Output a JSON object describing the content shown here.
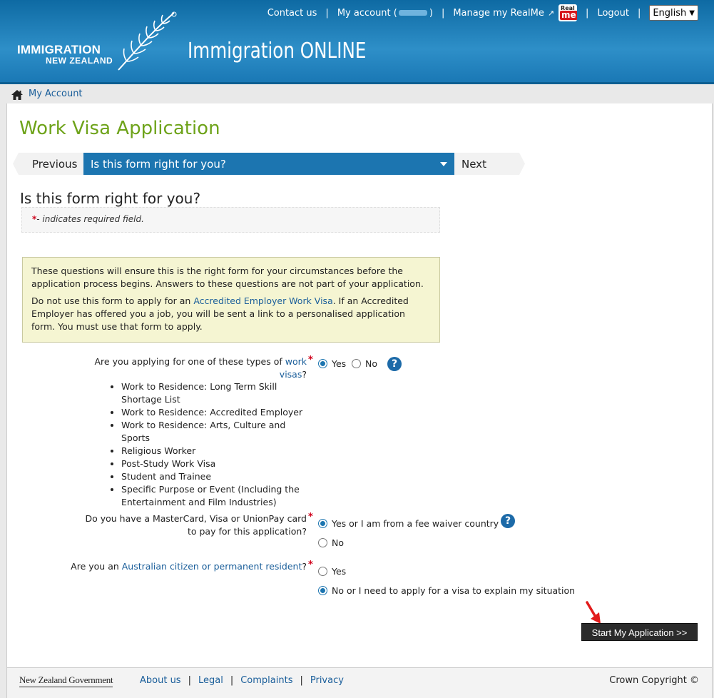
{
  "header": {
    "logo_line1": "IMMIGRATION",
    "logo_line2": "NEW ZEALAND",
    "site_title": "Immigration ONLINE",
    "nav": {
      "contact": "Contact us",
      "my_account": "My account (",
      "my_account_close": ")",
      "realme": "Manage my RealMe",
      "logout": "Logout",
      "language": "English"
    },
    "realme_badge_top": "Real",
    "realme_badge_bottom": "me"
  },
  "breadcrumb": {
    "label": "My Account"
  },
  "page": {
    "title": "Work Visa Application",
    "step": {
      "previous": "Previous",
      "current": "Is this form right for you?",
      "next": "Next"
    },
    "section_title": "Is this form right for you?",
    "required_star": "*",
    "required_note": "- indicates required field.",
    "info": {
      "p1": "These questions will ensure this is the right form for your circumstances before the application process begins. Answers to these questions are not part of your application.",
      "p2_before": "Do not use this form to apply for an ",
      "p2_link": "Accredited Employer Work Visa",
      "p2_after": ". If an Accredited Employer has offered you a job, you will be sent a link to a personalised application form. You must use that form to apply."
    }
  },
  "questions": {
    "q1": {
      "label_before": "Are you applying for one of these types of ",
      "label_link_a": "work",
      "label_link_b": "visas",
      "label_after": "?",
      "list": [
        "Work to Residence: Long Term Skill Shortage List",
        "Work to Residence: Accredited Employer",
        "Work to Residence: Arts, Culture and Sports",
        "Religious Worker",
        "Post-Study Work Visa",
        "Student and Trainee",
        "Specific Purpose or Event (Including the Entertainment and Film Industries)"
      ],
      "yes": "Yes",
      "no": "No"
    },
    "q2": {
      "label": "Do you have a MasterCard, Visa or UnionPay card to pay for this application?",
      "yes": "Yes or I am from a fee waiver country",
      "no": "No"
    },
    "q3": {
      "label_before": "Are you an ",
      "label_link": "Australian citizen or permanent resident",
      "label_after": "?",
      "yes": "Yes",
      "no": "No or I need to apply for a visa to explain my situation"
    },
    "help": "?"
  },
  "start_button": "Start My Application >>",
  "footer": {
    "gov": "New Zealand Government",
    "links": [
      "About us",
      "Legal",
      "Complaints",
      "Privacy"
    ],
    "copyright": "Crown Copyright ©"
  },
  "colors": {
    "header_blue": "#1a78b5",
    "title_green": "#6ea31a",
    "required_red": "#d0021b",
    "info_bg": "#f5f5d2"
  }
}
